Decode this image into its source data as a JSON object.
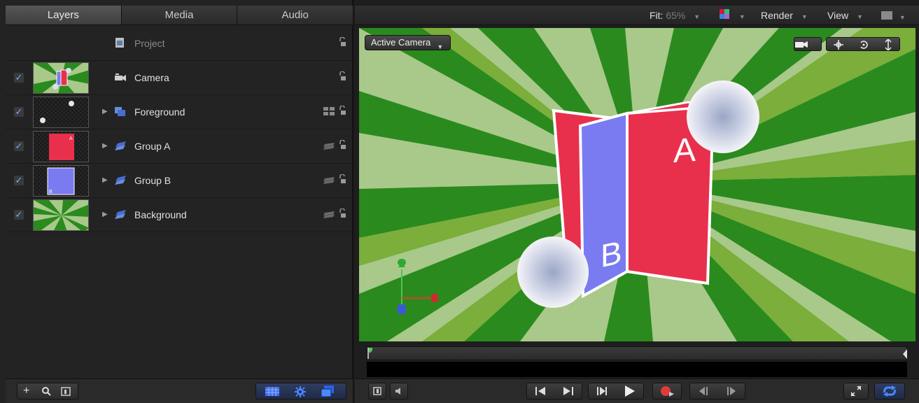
{
  "tabs": [
    {
      "label": "Layers",
      "active": true
    },
    {
      "label": "Media",
      "active": false
    },
    {
      "label": "Audio",
      "active": false
    }
  ],
  "layers": [
    {
      "name": "Project",
      "checked": null,
      "icon": "project-icon",
      "disabled": true
    },
    {
      "name": "Camera",
      "checked": true,
      "icon": "camera-icon"
    },
    {
      "name": "Foreground",
      "checked": true,
      "icon": "group-icon"
    },
    {
      "name": "Group  A",
      "checked": true,
      "icon": "group-stack-icon"
    },
    {
      "name": "Group B",
      "checked": true,
      "icon": "group-stack-icon"
    },
    {
      "name": "Background",
      "checked": true,
      "icon": "group-stack-icon"
    }
  ],
  "toolbar": {
    "fit_label": "Fit:",
    "fit_value": "65%",
    "render_label": "Render",
    "view_label": "View"
  },
  "canvas": {
    "camera_select": "Active Camera",
    "card_a_letter": "A",
    "card_b_letter": "B",
    "colors": {
      "dark_green": "#2a8a1e",
      "light_green": "#a8c98a",
      "mid_green": "#7bae3a",
      "red": "#e8304d",
      "blue": "#7a7bf0"
    }
  },
  "left_footer": {
    "add": "+",
    "search": "search-icon",
    "export": "thumbnail-icon"
  },
  "icons": {
    "checkbox": "✓",
    "lock": "lock-icon",
    "disclosure": "▶"
  }
}
